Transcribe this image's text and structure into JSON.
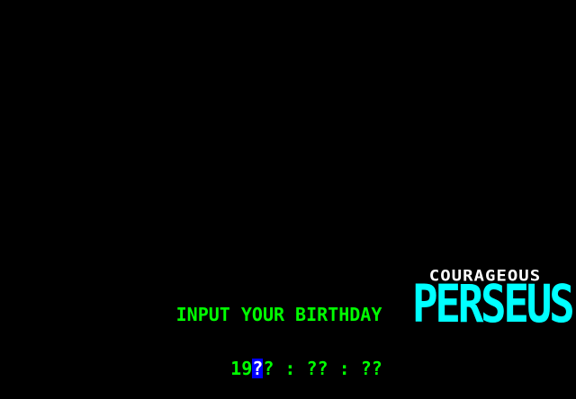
{
  "title_screen": {
    "subtitle": "COURAGEOUS",
    "title": "PERSEUS"
  },
  "birthday_prompt": {
    "label": "INPUT YOUR BIRTHDAY",
    "year_prefix": "19",
    "year_tens": "?",
    "year_ones": "?",
    "separator_1": " : ",
    "month": "??",
    "separator_2": " : ",
    "day": "??"
  },
  "colors": {
    "background": "#000000",
    "title": "#00ffff",
    "subtitle": "#ffffff",
    "prompt": "#00ff00",
    "cursor_bg": "#0000ff",
    "cursor_fg": "#ffffff"
  }
}
